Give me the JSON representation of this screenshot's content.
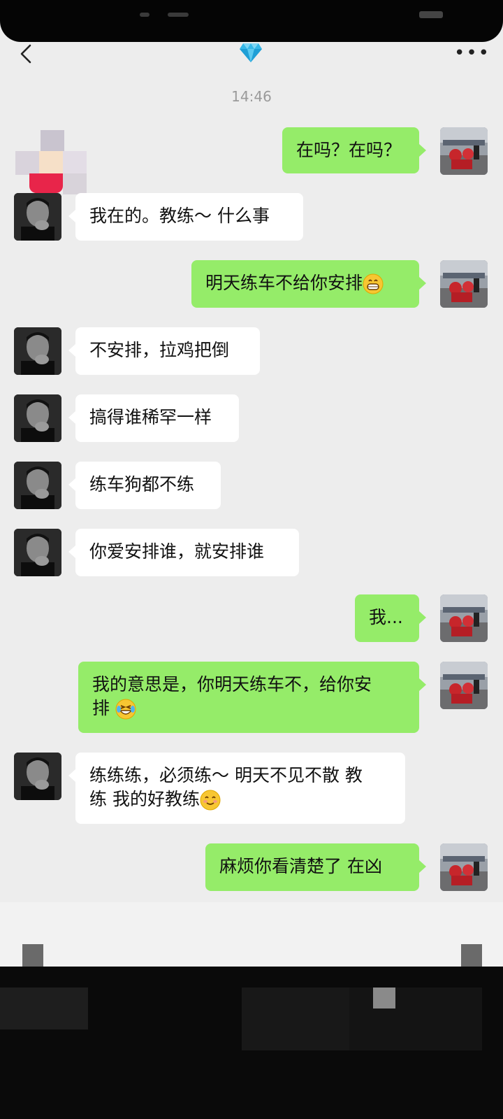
{
  "header": {
    "back_icon": "chevron-left-icon",
    "title_icon": "diamond-icon",
    "more_label": "•••"
  },
  "time": "14:46",
  "messages": [
    {
      "side": "self",
      "text": "在吗？在吗？"
    },
    {
      "side": "other",
      "text": "我在的。教练～ 什么事"
    },
    {
      "side": "self",
      "text": "明天练车不给你安排",
      "emoji": "grinning-face-icon"
    },
    {
      "side": "other",
      "text": "不安排，拉鸡把倒"
    },
    {
      "side": "other",
      "text": "搞得谁稀罕一样"
    },
    {
      "side": "other",
      "text": "练车狗都不练"
    },
    {
      "side": "other",
      "text": "你爱安排谁，就安排谁"
    },
    {
      "side": "self",
      "text": "我..."
    },
    {
      "side": "self",
      "line1": "我的意思是，你明天练车不，给你安",
      "line2": "排",
      "emoji": "laughing-crying-face-icon"
    },
    {
      "side": "other",
      "line1": "练练练，必须练～ 明天不见不散 教",
      "line2": "练 我的好教练",
      "emoji": "smiling-face-icon"
    },
    {
      "side": "self",
      "text": "麻烦你看清楚了 在凶"
    }
  ],
  "colors": {
    "background": "#ededed",
    "self_bubble": "#95ec69",
    "other_bubble": "#ffffff"
  }
}
